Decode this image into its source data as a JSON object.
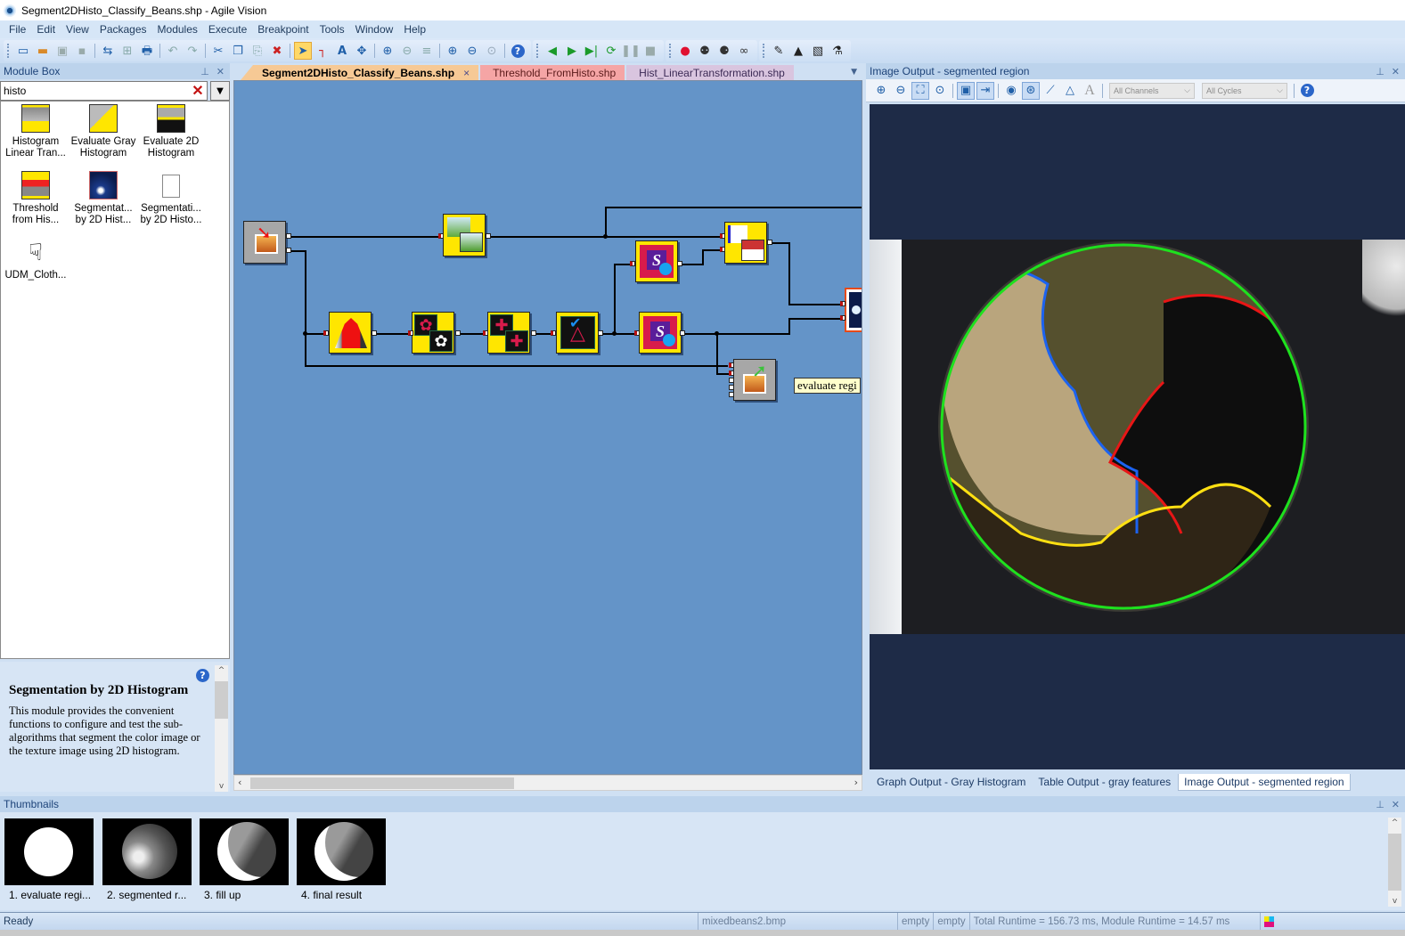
{
  "window": {
    "title": "Segment2DHisto_Classify_Beans.shp - Agile Vision",
    "app_icon": "eye-icon"
  },
  "menu": [
    "File",
    "Edit",
    "View",
    "Packages",
    "Modules",
    "Execute",
    "Breakpoint",
    "Tools",
    "Window",
    "Help"
  ],
  "toolbar": {
    "groups": [
      [
        "new-window-icon",
        "open-icon",
        "save-icon",
        "save-all-icon",
        "|",
        "import-image-icon",
        "export-table-icon",
        "print-icon",
        "|",
        "undo-icon",
        "redo-icon",
        "|",
        "cut-icon",
        "copy-icon",
        "paste-icon",
        "delete-icon",
        "|",
        "pointer-icon",
        "connector-icon",
        "text-icon",
        "move-icon",
        "|",
        "group-icon",
        "ungroup-icon",
        "align-icon",
        "|",
        "zoom-in-icon",
        "zoom-out-icon",
        "zoom-fit-icon",
        "|",
        "help-icon"
      ],
      [
        "step-back-icon",
        "run-icon",
        "step-forward-icon",
        "loop-icon",
        "pause-icon",
        "stop-icon"
      ],
      [
        "breakpoint-icon",
        "clear-breakpoints-icon",
        "toggle-breakpoint-icon",
        "link-icon"
      ],
      [
        "eyedropper-icon",
        "histogram-icon",
        "graph-icon",
        "flask-icon"
      ]
    ],
    "active": "pointer-icon"
  },
  "module_box": {
    "title": "Module Box",
    "search_value": "histo",
    "items": [
      {
        "label": "Histogram Linear Tran...",
        "icon": "histogram-linear-icon"
      },
      {
        "label": "Evaluate Gray Histogram",
        "icon": "evaluate-gray-histogram-icon"
      },
      {
        "label": "Evaluate 2D Histogram",
        "icon": "evaluate-2d-histogram-icon"
      },
      {
        "label": "Threshold from His...",
        "icon": "threshold-histogram-icon"
      },
      {
        "label": "Segmentat... by 2D Hist...",
        "icon": "segmentation-2d-icon"
      },
      {
        "label": "Segmentati... by 2D Histo...",
        "icon": "segmentation-2d-blank-icon"
      },
      {
        "label": "UDM_Cloth...",
        "icon": "hand-icon"
      }
    ]
  },
  "help": {
    "title": "Segmentation by 2D Histogram",
    "body": "This module provides the convenient functions to configure and test the sub-algorithms that segment the color image or the texture image using 2D histogram."
  },
  "doc_tabs": [
    {
      "label": "Segment2DHisto_Classify_Beans.shp",
      "active": true,
      "closable": true
    },
    {
      "label": "Threshold_FromHisto.shp",
      "active": false
    },
    {
      "label": "Hist_LinearTransformation.shp",
      "active": false
    }
  ],
  "canvas": {
    "tooltip": "evaluate regi",
    "nodes": [
      {
        "id": "load-image",
        "icon": "load-image-icon"
      },
      {
        "id": "image-copy",
        "icon": "image-copy-icon"
      },
      {
        "id": "compose-output",
        "icon": "compose-output-icon"
      },
      {
        "id": "histogram-threshold",
        "icon": "bell-curve-icon"
      },
      {
        "id": "texture-feature",
        "icon": "paw-icon"
      },
      {
        "id": "region-combine",
        "icon": "puzzle-icon"
      },
      {
        "id": "shape-check",
        "icon": "shapes-check-icon"
      },
      {
        "id": "script-a",
        "icon": "script-icon"
      },
      {
        "id": "script-b",
        "icon": "script-icon"
      },
      {
        "id": "image-output",
        "icon": "image-output-icon"
      },
      {
        "id": "evaluate-region",
        "icon": "evaluate-region-icon"
      }
    ]
  },
  "image_output": {
    "title": "Image Output - segmented region",
    "channels": "All Channels",
    "cycles": "All Cycles",
    "tools": [
      "zoom-in-icon",
      "zoom-out-icon",
      "fit-icon",
      "zoom-region-icon",
      "|",
      "show-image-icon",
      "export-image-icon",
      "|",
      "overlay-icon",
      "grid-icon",
      "line-icon",
      "polygon-icon",
      "text-icon"
    ],
    "overlay_colors": {
      "green": "#1ee11e",
      "blue": "#1c63f0",
      "red": "#e81616",
      "yellow": "#ffe012"
    },
    "tabs": [
      {
        "label": "Graph Output - Gray Histogram",
        "active": false
      },
      {
        "label": "Table Output - gray features",
        "active": false
      },
      {
        "label": "Image Output - segmented region",
        "active": true
      }
    ]
  },
  "thumbnails": {
    "title": "Thumbnails",
    "items": [
      {
        "label": "1. evaluate regi..."
      },
      {
        "label": "2. segmented r..."
      },
      {
        "label": "3. fill up"
      },
      {
        "label": "4. final result"
      }
    ]
  },
  "status": {
    "ready": "Ready",
    "file": "mixedbeans2.bmp",
    "empty1": "empty",
    "empty2": "empty",
    "runtime": "Total Runtime = 156.73 ms, Module Runtime = 14.57 ms"
  }
}
